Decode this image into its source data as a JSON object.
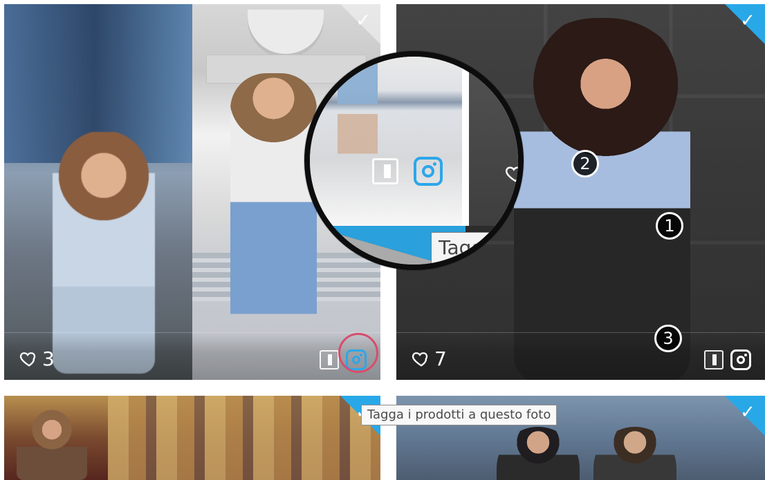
{
  "gallery": {
    "cards": [
      {
        "likes": "3",
        "selected": true,
        "has_magnifier_focus": true
      },
      {
        "likes": "7",
        "selected": true,
        "markers": [
          "1",
          "2",
          "3"
        ]
      },
      {
        "selected": true
      },
      {
        "selected": true
      }
    ],
    "magnifier": {
      "zoom_tooltip_text": "Tagg"
    },
    "tooltip": {
      "text": "Tagga i prodotti a questo foto"
    },
    "colors": {
      "accent": "#29a8e8",
      "highlight": "#d94c6d",
      "white": "#ffffff",
      "dark": "#111111"
    },
    "icons": {
      "selected": "checkmark-icon",
      "likes": "heart-icon",
      "tag_products": "instagram-icon",
      "view_mode": "panel-icon"
    }
  }
}
